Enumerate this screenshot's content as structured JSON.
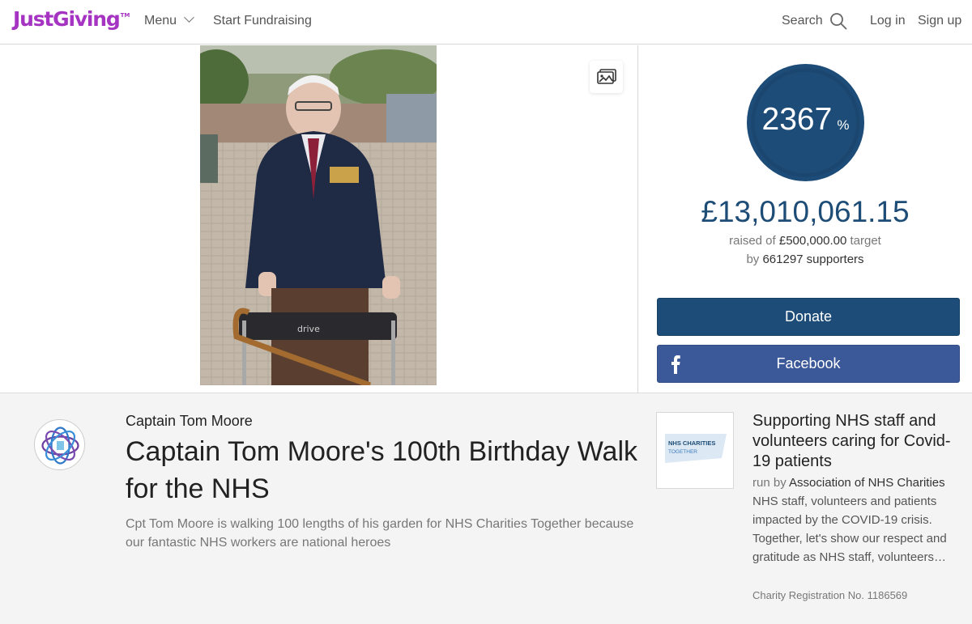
{
  "header": {
    "logo": "JustGiving",
    "logo_tm": "TM",
    "menu_label": "Menu",
    "start_label": "Start Fundraising",
    "search_label": "Search",
    "login_label": "Log in",
    "signup_label": "Sign up"
  },
  "progress": {
    "percent": "2367",
    "percent_sign": "%",
    "fraction_complete": 1.0
  },
  "totals": {
    "amount": "£13,010,061.15",
    "raised_prefix": "raised of",
    "target": "£500,000.00",
    "target_suffix": "target",
    "by_prefix": "by",
    "supporters": "661297 supporters"
  },
  "actions": {
    "donate_label": "Donate",
    "facebook_label": "Facebook"
  },
  "page": {
    "owner": "Captain Tom Moore",
    "title": "Captain Tom Moore's 100th Birthday Walk for the NHS",
    "summary": "Cpt Tom Moore is walking 100 lengths of his garden for NHS Charities Together because our fantastic NHS workers are national heroes"
  },
  "charity": {
    "logo_line1": "NHS CHARITIES",
    "logo_line2": "TOGETHER",
    "title": "Supporting NHS staff and volunteers caring for Covid-19 patients",
    "run_by_prefix": "run by",
    "name": "Association of NHS Charities",
    "description": "NHS staff, volunteers and patients impacted by the COVID-19 crisis. Together, let's show our respect and gratitude as NHS staff, volunteers…",
    "registration": "Charity Registration No. 1186569"
  },
  "colors": {
    "brand": "#a634c2",
    "primary": "#1c4c77",
    "facebook": "#3b5998"
  }
}
